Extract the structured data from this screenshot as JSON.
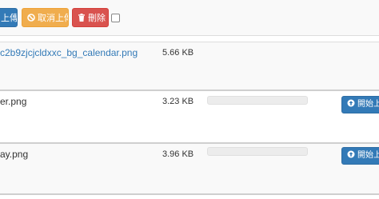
{
  "toolbar": {
    "upload_label": "上傳",
    "cancel_label": "取消上傳",
    "delete_label": "刪除"
  },
  "files": [
    {
      "name": "c2b9zjcjcldxxc_bg_calendar.png",
      "size": "5.66 KB"
    },
    {
      "name": "er.png",
      "size": "3.23 KB",
      "progress": 0,
      "start_label": "開始上"
    },
    {
      "name": "ay.png",
      "size": "3.96 KB",
      "progress": 0,
      "start_label": "開始上"
    }
  ],
  "colors": {
    "primary": "#337ab7",
    "warning": "#f0ad4e",
    "danger": "#d9534f",
    "link": "#337ab7"
  },
  "icons": {
    "cancel": "ban-circle-icon",
    "delete": "trash-icon",
    "start": "upload-circle-icon"
  }
}
